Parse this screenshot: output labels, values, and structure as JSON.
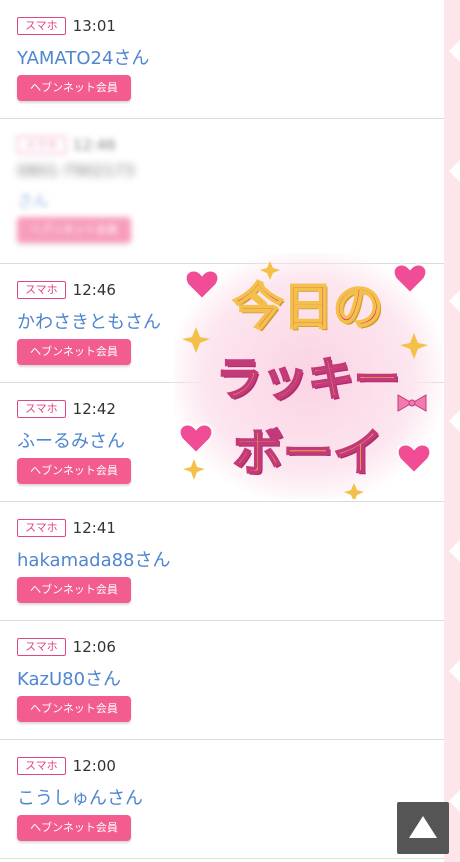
{
  "entries": [
    {
      "device": "スマホ",
      "time": "13:01",
      "name": "YAMATO24さん",
      "member_label": "ヘブンネット会員"
    },
    {
      "device": "スマホ",
      "time": "12:46",
      "phone": "0801-7902173",
      "name": "さん",
      "member_label": "ヘブンネット会員"
    },
    {
      "device": "スマホ",
      "time": "12:46",
      "name": "かわさきともさん",
      "member_label": "ヘブンネット会員"
    },
    {
      "device": "スマホ",
      "time": "12:42",
      "name": "ふーるみさん",
      "member_label": "ヘブンネット会員"
    },
    {
      "device": "スマホ",
      "time": "12:41",
      "name": "hakamada88さん",
      "member_label": "ヘブンネット会員"
    },
    {
      "device": "スマホ",
      "time": "12:06",
      "name": "KazU80さん",
      "member_label": "ヘブンネット会員"
    },
    {
      "device": "スマホ",
      "time": "12:00",
      "name": "こうしゅんさん",
      "member_label": "ヘブンネット会員"
    }
  ],
  "lucky_banner": {
    "line1": "今日の",
    "line2": "ラッキー",
    "line3": "ボーイ"
  },
  "scroll_top_icon": "triangle-up-icon",
  "colors": {
    "accent_pink": "#f25c8e",
    "name_blue": "#4f86d1",
    "badge_pink": "#e0468a"
  }
}
